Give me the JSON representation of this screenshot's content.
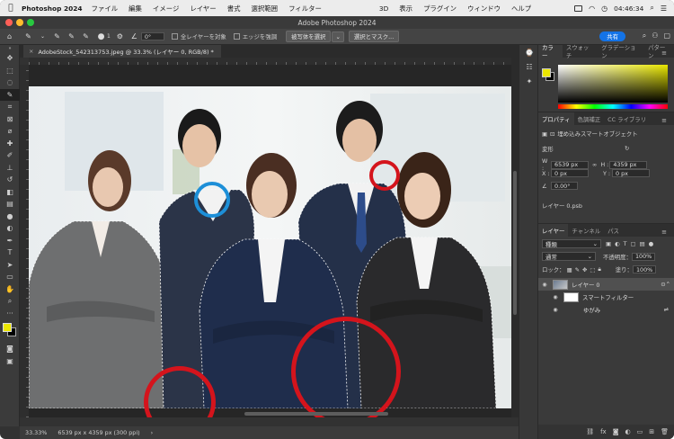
{
  "menubar": {
    "apple_icon": "apple-icon",
    "app_name": "Photoshop 2024",
    "items": [
      "ファイル",
      "編集",
      "イメージ",
      "レイヤー",
      "書式",
      "選択範囲",
      "フィルター",
      "3D",
      "表示",
      "プラグイン",
      "ウィンドウ",
      "ヘルプ"
    ],
    "clock": "04:46:34"
  },
  "titlebar": {
    "title": "Adobe Photoshop 2024"
  },
  "options": {
    "brush_size": "1",
    "angle": "0°",
    "all_layers": "全レイヤーを対象",
    "enhance_edge": "エッジを強調",
    "select_subject": "被写体を選択",
    "select_and_mask": "選択とマスク...",
    "share": "共有"
  },
  "document": {
    "tab_label": "AdobeStock_542313753.jpeg @ 33.3% (レイヤー 0, RGB/8) *",
    "zoom": "33.33%",
    "doc_info": "6539 px x 4359 px (300 ppi)"
  },
  "color_panel": {
    "tabs": [
      "カラー",
      "スウォッチ",
      "グラデーション",
      "パターン"
    ],
    "fg_color": "#ebe600",
    "bg_color": "#000000"
  },
  "properties_panel": {
    "tabs": [
      "プロパティ",
      "色調補正",
      "CC ライブラリ"
    ],
    "object_type": "埋め込みスマートオブジェクト",
    "section": "変形",
    "w_label": "W :",
    "w": "6539 px",
    "h_label": "H :",
    "h": "4359 px",
    "x_label": "X :",
    "x": "0 px",
    "y_label": "Y :",
    "y": "0 px",
    "angle": "0.00°",
    "file": "レイヤー 0.psb"
  },
  "layers_panel": {
    "tabs": [
      "レイヤー",
      "チャンネル",
      "パス"
    ],
    "filter_kind": "種類",
    "blend_mode": "通常",
    "opacity_label": "不透明度：",
    "opacity": "100%",
    "lock_label": "ロック：",
    "fill_label": "塗り：",
    "fill": "100%",
    "layers": [
      {
        "name": "レイヤー 0"
      },
      {
        "name": "スマートフィルター"
      },
      {
        "name": "ゆがみ"
      }
    ]
  },
  "annotations": {
    "red": "#d4141c",
    "blue": "#1d8fd8"
  }
}
